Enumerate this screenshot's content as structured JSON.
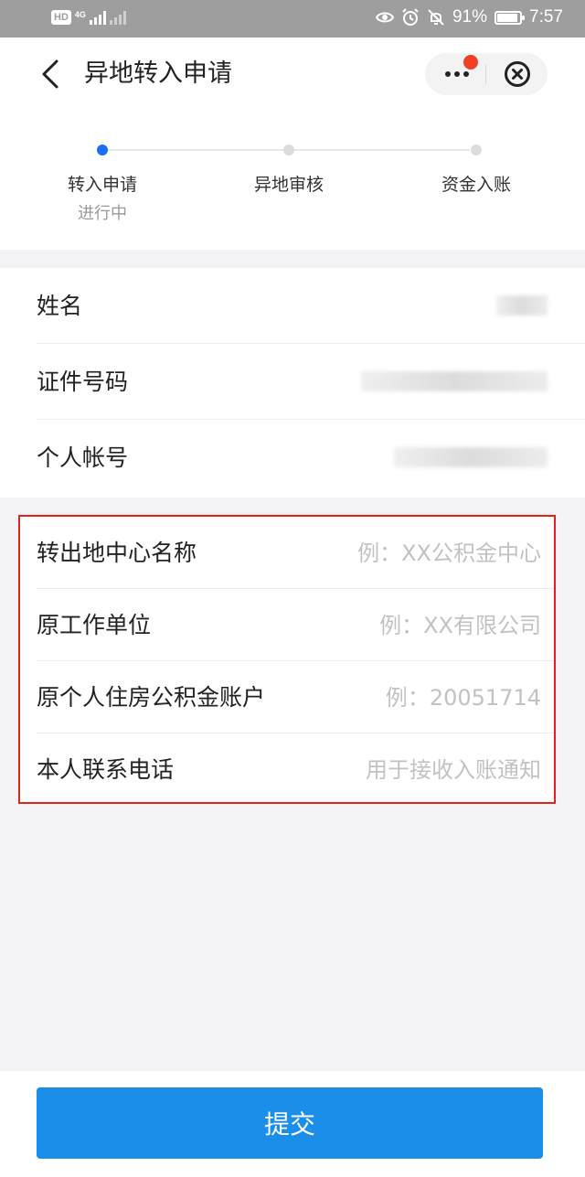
{
  "status_bar": {
    "hd": "HD",
    "network": "4G",
    "battery_percent": "91%",
    "battery_level": 0.91,
    "time": "7:57"
  },
  "header": {
    "title": "异地转入申请"
  },
  "steps": [
    {
      "label": "转入申请",
      "status": "进行中",
      "active": true
    },
    {
      "label": "异地审核",
      "status": "",
      "active": false
    },
    {
      "label": "资金入账",
      "status": "",
      "active": false
    }
  ],
  "info": [
    {
      "label": "姓名"
    },
    {
      "label": "证件号码"
    },
    {
      "label": "个人帐号"
    }
  ],
  "form": [
    {
      "label": "转出地中心名称",
      "placeholder": "例：XX公积金中心"
    },
    {
      "label": "原工作单位",
      "placeholder": "例：XX有限公司"
    },
    {
      "label": "原个人住房公积金账户",
      "placeholder": "例：20051714"
    },
    {
      "label": "本人联系电话",
      "placeholder": "用于接收入账通知"
    }
  ],
  "submit_label": "提交",
  "colors": {
    "primary": "#1a8ee8",
    "step_active": "#1b6ff5",
    "badge_red": "#f04124",
    "highlight_border": "#e0241b"
  }
}
